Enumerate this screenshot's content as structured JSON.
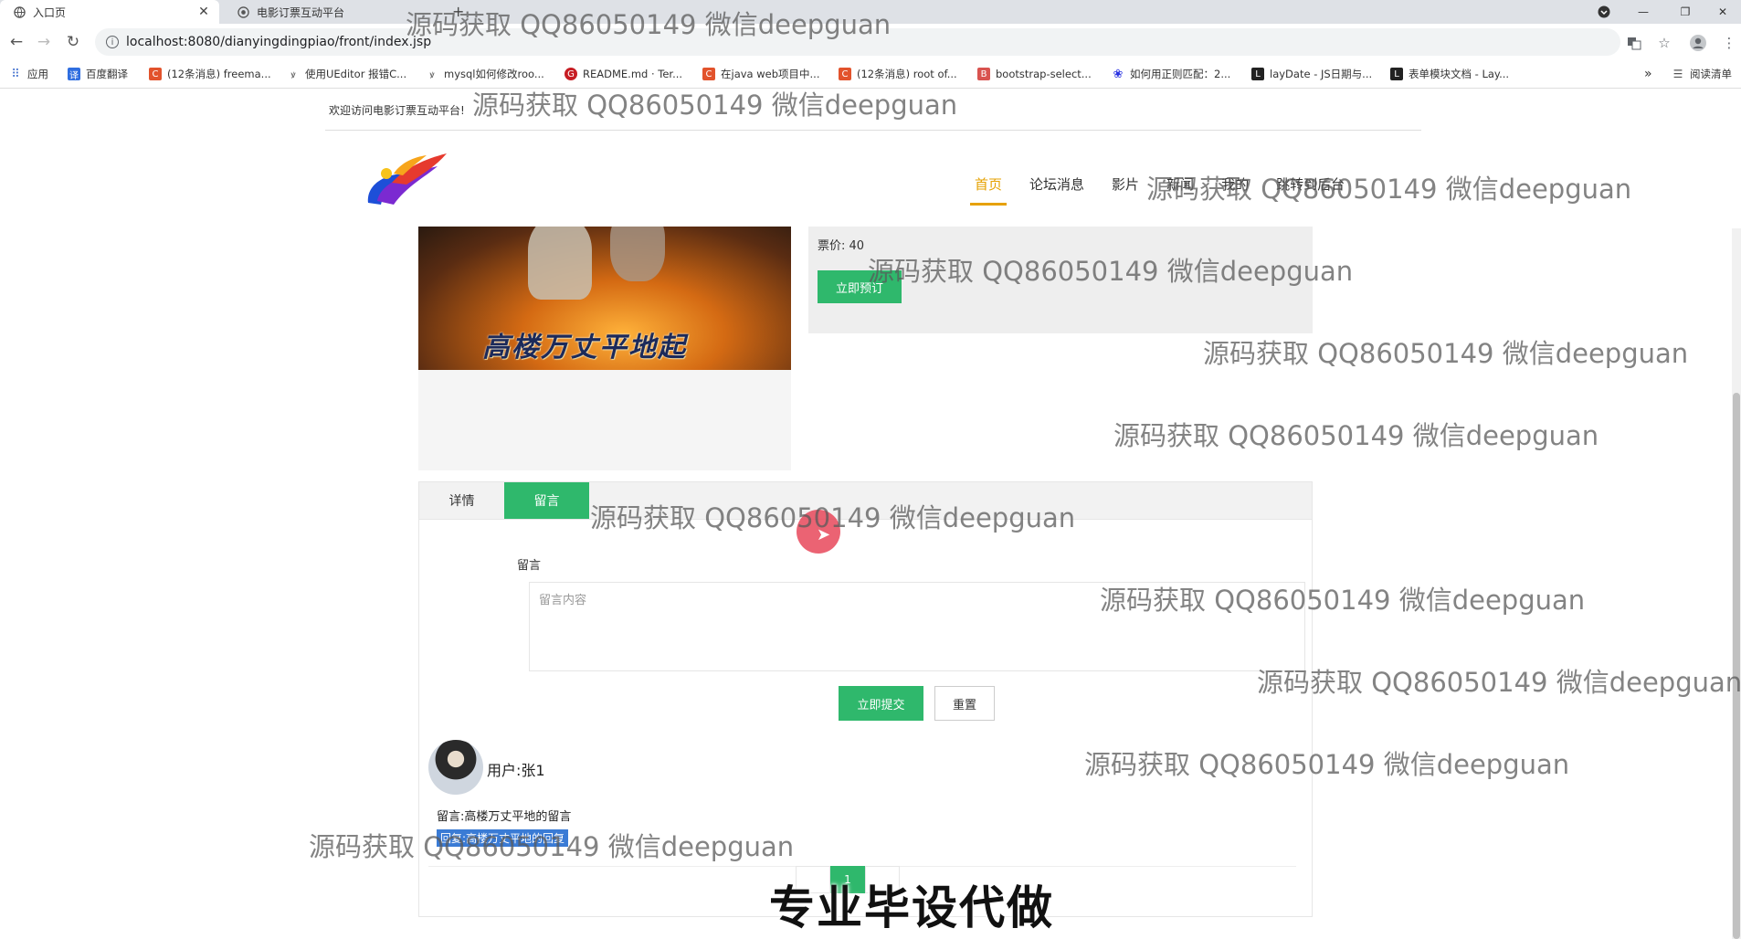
{
  "browser": {
    "tabs": [
      {
        "title": "入口页",
        "active": true
      },
      {
        "title": "电影订票互动平台",
        "active": false
      }
    ],
    "new_tab": "+",
    "url": "localhost:8080/dianyingdingpiao/front/index.jsp",
    "bookmarks": [
      {
        "label": "应用",
        "icon": "apps-grid-icon",
        "color": "#4a76d0"
      },
      {
        "label": "百度翻译",
        "icon": "translate-icon",
        "color": "#2f6ee0"
      },
      {
        "label": "(12条消息) freema...",
        "icon": "csdn-icon",
        "color": "#e2532c"
      },
      {
        "label": "使用UEditor 报错C...",
        "icon": "ueditor-icon",
        "color": "#555555"
      },
      {
        "label": "mysql如何修改roo...",
        "icon": "ueditor-icon",
        "color": "#555555"
      },
      {
        "label": "README.md · Ter...",
        "icon": "gitee-icon",
        "color": "#c71d23"
      },
      {
        "label": "在java web项目中...",
        "icon": "csdn-icon",
        "color": "#e2532c"
      },
      {
        "label": "(12条消息) root of...",
        "icon": "csdn-icon",
        "color": "#e2532c"
      },
      {
        "label": "bootstrap-select...",
        "icon": "bootstrap-icon",
        "color": "#d9534f"
      },
      {
        "label": "如何用正则匹配：2...",
        "icon": "baidu-icon",
        "color": "#2932e1"
      },
      {
        "label": "layDate - JS日期与...",
        "icon": "layui-icon",
        "color": "#222222"
      },
      {
        "label": "表单模块文档 - Lay...",
        "icon": "layui-icon",
        "color": "#222222"
      }
    ],
    "more_bookmarks": "»",
    "reading_list": "阅读清单"
  },
  "site": {
    "welcome": "欢迎访问电影订票互动平台!",
    "nav": [
      {
        "label": "首页",
        "active": true
      },
      {
        "label": "论坛消息",
        "active": false
      },
      {
        "label": "影片",
        "active": false
      },
      {
        "label": "新闻",
        "active": false
      },
      {
        "label": "我的",
        "active": false
      },
      {
        "label": "跳转到后台",
        "active": false
      }
    ]
  },
  "movie": {
    "poster_title": "高楼万丈平地起",
    "price_label": "票价:",
    "price_value": "40",
    "book_button": "立即预订"
  },
  "detail_tabs": [
    {
      "label": "详情",
      "active": false
    },
    {
      "label": "留言",
      "active": true
    }
  ],
  "message_form": {
    "label": "留言",
    "placeholder": "留言内容",
    "submit": "立即提交",
    "reset": "重置"
  },
  "comments": [
    {
      "user_label": "用户:",
      "user_name": "张1",
      "text": "留言:高楼万丈平地的留言",
      "reply": "回复:高楼万丈平地的回复"
    }
  ],
  "pagination": {
    "current": "1"
  },
  "watermark": "源码获取 QQ86050149 微信deepguan",
  "banner": "专业毕设代做",
  "colors": {
    "accent_green": "#2fb86c",
    "nav_active": "#e6a100"
  }
}
